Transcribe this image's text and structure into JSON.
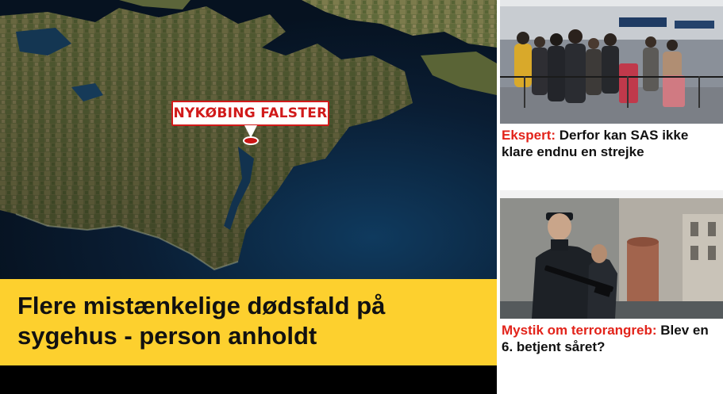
{
  "main_story": {
    "map_label": "NYKØBING FALSTER",
    "headline": "Flere mistænkelige dødsfald på sygehus - person anholdt",
    "headline_bg": "#fdd02e",
    "pin_color": "#d11a1a"
  },
  "side_stories": [
    {
      "kicker": "Ekspert:",
      "title": "Derfor kan SAS ikke klare endnu en strejke",
      "image": "airport-queue-photo"
    },
    {
      "kicker": "Mystik om terrorangreb:",
      "title": "Blev en 6. betjent såret?",
      "image": "armed-police-photo"
    }
  ],
  "colors": {
    "kicker": "#e2231a",
    "text": "#111111"
  }
}
